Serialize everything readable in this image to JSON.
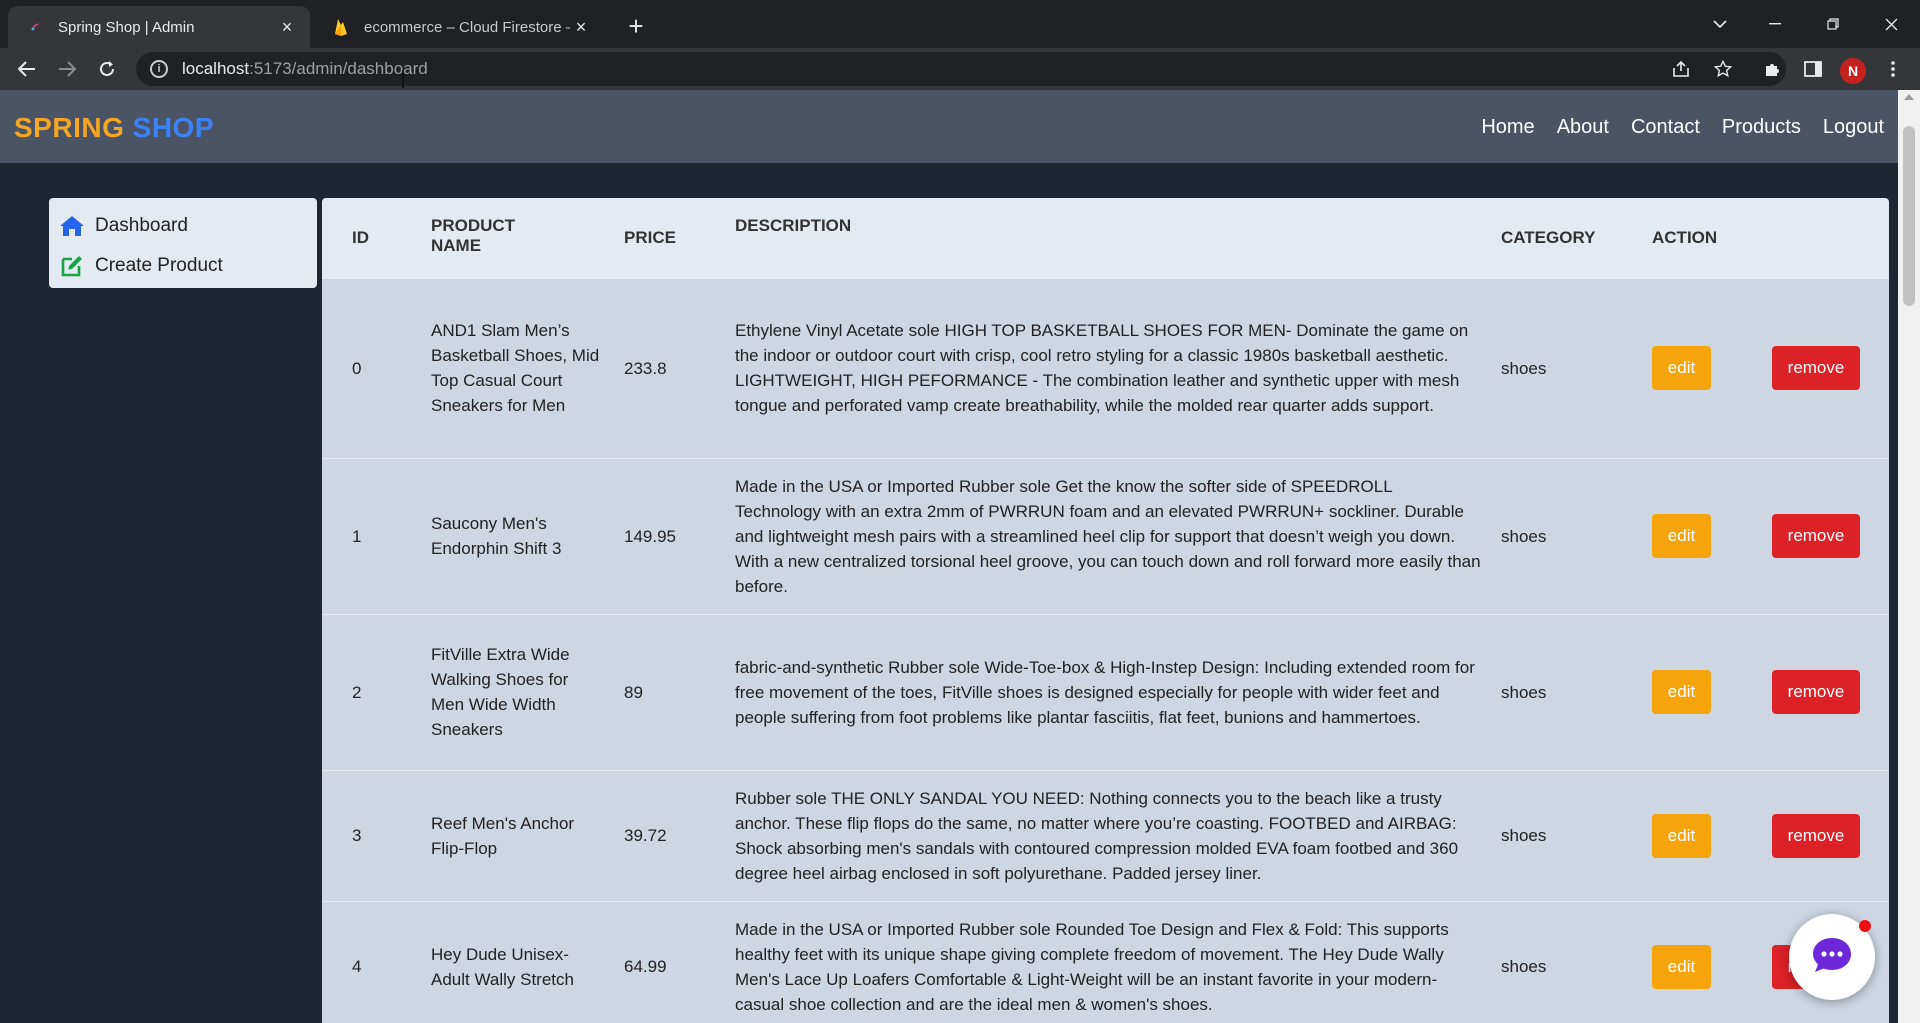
{
  "browser": {
    "tabs": [
      {
        "title": "Spring Shop | Admin",
        "active": true
      },
      {
        "title": "ecommerce – Cloud Firestore – F",
        "active": false
      }
    ],
    "url_host": "localhost",
    "url_path": ":5173/admin/dashboard",
    "profile_initial": "N"
  },
  "navbar": {
    "brand_part1": "SPRING",
    "brand_part2": "SHOP",
    "links": [
      "Home",
      "About",
      "Contact",
      "Products",
      "Logout"
    ]
  },
  "sidebar": {
    "items": [
      {
        "label": "Dashboard",
        "icon": "home-icon"
      },
      {
        "label": "Create Product",
        "icon": "edit-square-icon"
      }
    ]
  },
  "table": {
    "headers": {
      "id": "ID",
      "product_name_1": "PRODUCT",
      "product_name_2": "NAME",
      "price": "PRICE",
      "description": "DESCRIPTION",
      "category": "CATEGORY",
      "action": "ACTION"
    },
    "edit_label": "edit",
    "remove_label": "remove",
    "rows": [
      {
        "id": "0",
        "name": "AND1 Slam Men’s Basketball Shoes, Mid Top Casual Court Sneakers for Men",
        "price": "233.8",
        "description": "Ethylene Vinyl Acetate sole HIGH TOP BASKETBALL SHOES FOR MEN- Dominate the game on the indoor or outdoor court with crisp, cool retro styling for a classic 1980s basketball aesthetic. LIGHTWEIGHT, HIGH PEFORMANCE - The combination leather and synthetic upper with mesh tongue and perforated vamp create breathability, while the molded rear quarter adds support.",
        "category": "shoes"
      },
      {
        "id": "1",
        "name": "Saucony Men's Endorphin Shift 3",
        "price": "149.95",
        "description": "Made in the USA or Imported Rubber sole Get the know the softer side of SPEEDROLL Technology with an extra 2mm of PWRRUN foam and an elevated PWRRUN+ sockliner. Durable and lightweight mesh pairs with a streamlined heel clip for support that doesn’t weigh you down. With a new centralized torsional heel groove, you can touch down and roll forward more easily than before.",
        "category": "shoes"
      },
      {
        "id": "2",
        "name": "FitVille Extra Wide Walking Shoes for Men Wide Width Sneakers",
        "price": "89",
        "description": "fabric-and-synthetic Rubber sole Wide-Toe-box & High-Instep Design: Including extended room for free movement of the toes, FitVille shoes is designed especially for people with wider feet and people suffering from foot problems like plantar fasciitis, flat feet, bunions and hammertoes.",
        "category": "shoes"
      },
      {
        "id": "3",
        "name": "Reef Men's Anchor Flip-Flop",
        "price": "39.72",
        "description": "Rubber sole THE ONLY SANDAL YOU NEED: Nothing connects you to the beach like a trusty anchor. These flip flops do the same, no matter where you’re coasting. FOOTBED and AIRBAG: Shock absorbing men's sandals with contoured compression molded EVA foam footbed and 360 degree heel airbag enclosed in soft polyurethane. Padded jersey liner.",
        "category": "shoes"
      },
      {
        "id": "4",
        "name": "Hey Dude Unisex-Adult Wally Stretch",
        "price": "64.99",
        "description": "Made in the USA or Imported Rubber sole Rounded Toe Design and Flex & Fold: This supports healthy feet with its unique shape giving complete freedom of movement. The Hey Dude Wally Men's Lace Up Loafers Comfortable & Light-Weight will be an instant favorite in your modern-casual shoe collection and are the ideal men & women's shoes.",
        "category": "shoes"
      }
    ]
  },
  "colors": {
    "brand_orange": "#f5a623",
    "brand_blue": "#3b82f6",
    "edit_button": "#f5a50b",
    "remove_button": "#dc2127",
    "navbar_bg": "#4a5465",
    "page_bg": "#1e2632"
  }
}
